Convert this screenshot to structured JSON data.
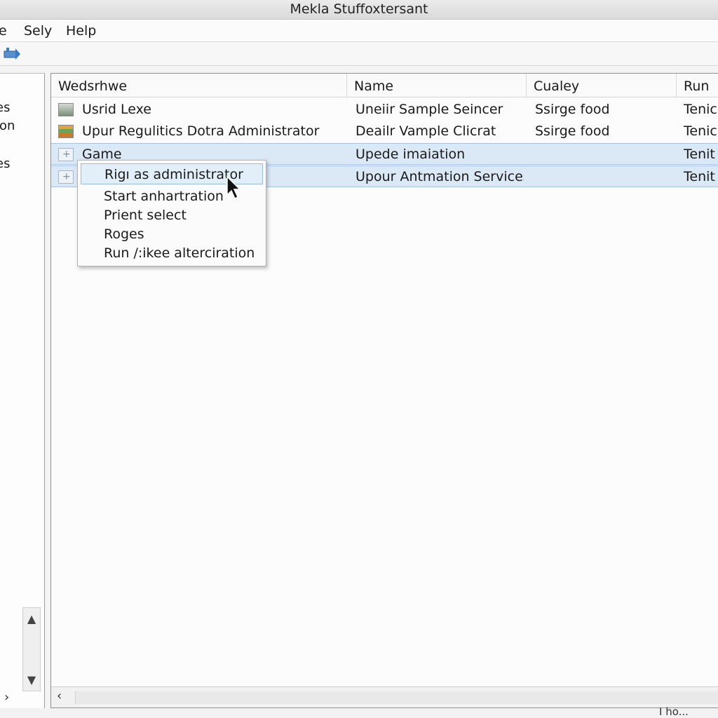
{
  "window": {
    "title": "Mekla Stuffoxtersant"
  },
  "menubar": {
    "items": [
      "e",
      "Sely",
      "Help"
    ]
  },
  "toolbar": {
    "icon": "transfer-icon"
  },
  "left_pane": {
    "items": [
      "",
      "es",
      "ion",
      "es"
    ]
  },
  "table": {
    "columns": [
      "Wedsrhwe",
      "Name",
      "Cualey",
      "Run"
    ],
    "rows": [
      {
        "cells": [
          "Usrid Lexe",
          "Uneiir Sample Seincer",
          "Ssirge food",
          "Tenic )"
        ],
        "icon": "app-icon",
        "selected": false
      },
      {
        "cells": [
          "Upur Regulitics Dotra Administrator",
          "Deailr Vample Clicrat",
          "Ssirge food",
          "Tenic l"
        ],
        "icon": "app-icon",
        "selected": false
      },
      {
        "cells": [
          "Game",
          "Upede imaiation",
          "",
          "Tenit ı"
        ],
        "icon": "folder-icon",
        "selected": true
      },
      {
        "cells": [
          "",
          "Upour Antmation Services",
          "",
          "Tenit ı"
        ],
        "icon": "folder-icon",
        "selected": true
      }
    ]
  },
  "context_menu": {
    "items": [
      "Rigı as administrator",
      "Start anhartration",
      "Prient select",
      "Roges",
      "Run /:ikee alterciration"
    ],
    "highlighted_index": 0
  },
  "status": {
    "text": "I ho..."
  }
}
